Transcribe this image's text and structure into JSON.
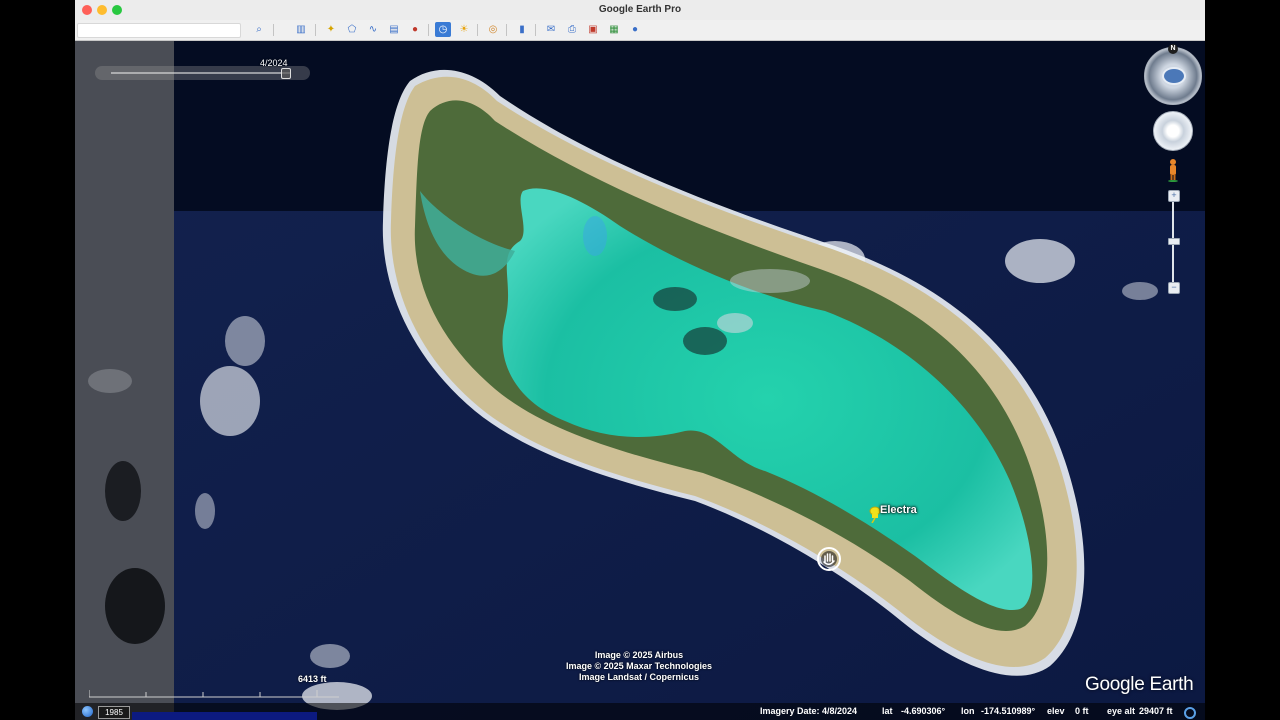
{
  "window": {
    "title": "Google Earth Pro"
  },
  "toolbar": {
    "buttons": [
      {
        "name": "search-icon",
        "glyph": "⌕"
      },
      {
        "name": "sidebar-toggle-icon",
        "glyph": "▥"
      },
      {
        "name": "add-placemark-icon",
        "glyph": "✦"
      },
      {
        "name": "add-polygon-icon",
        "glyph": "⬠"
      },
      {
        "name": "add-path-icon",
        "glyph": "∿"
      },
      {
        "name": "image-overlay-icon",
        "glyph": "▤"
      },
      {
        "name": "record-tour-icon",
        "glyph": "●"
      },
      {
        "name": "historical-imagery-icon",
        "glyph": "◷"
      },
      {
        "name": "sunlight-icon",
        "glyph": "☀"
      },
      {
        "name": "planets-icon",
        "glyph": "◎"
      },
      {
        "name": "ruler-icon",
        "glyph": "▮"
      },
      {
        "name": "email-icon",
        "glyph": "✉"
      },
      {
        "name": "print-icon",
        "glyph": "⎙"
      },
      {
        "name": "save-image-icon",
        "glyph": "▣"
      },
      {
        "name": "view-in-maps-icon",
        "glyph": "▦"
      },
      {
        "name": "earth-gallery-icon",
        "glyph": "●"
      }
    ]
  },
  "historical_imagery": {
    "date": "4/2024",
    "position_fraction": 0.97
  },
  "placemark": {
    "label": "Electra"
  },
  "attribution": {
    "line1": "Image © 2025 Airbus",
    "line2": "Image © 2025 Maxar Technologies",
    "line3": "Image Landsat / Copernicus"
  },
  "logo": {
    "text": "Google Earth"
  },
  "scale": {
    "label": "6413 ft"
  },
  "statusbar": {
    "tour_year": "1985",
    "imagery_date": "Imagery Date: 4/8/2024",
    "lat_label": "lat",
    "lat_value": "-4.690306°",
    "lon_label": "lon",
    "lon_value": "-174.510989°",
    "elev_label": "elev",
    "elev_value": "0 ft",
    "eye_alt_label": "eye alt",
    "eye_alt_value": "29407 ft"
  },
  "navigation": {
    "north_label": "N"
  },
  "colors": {
    "ocean": "#0f1d4a",
    "lagoon": "#20c9a8",
    "land": "#4e6b3a",
    "sand": "#cdbf95",
    "accent": "#3a7bd5"
  }
}
